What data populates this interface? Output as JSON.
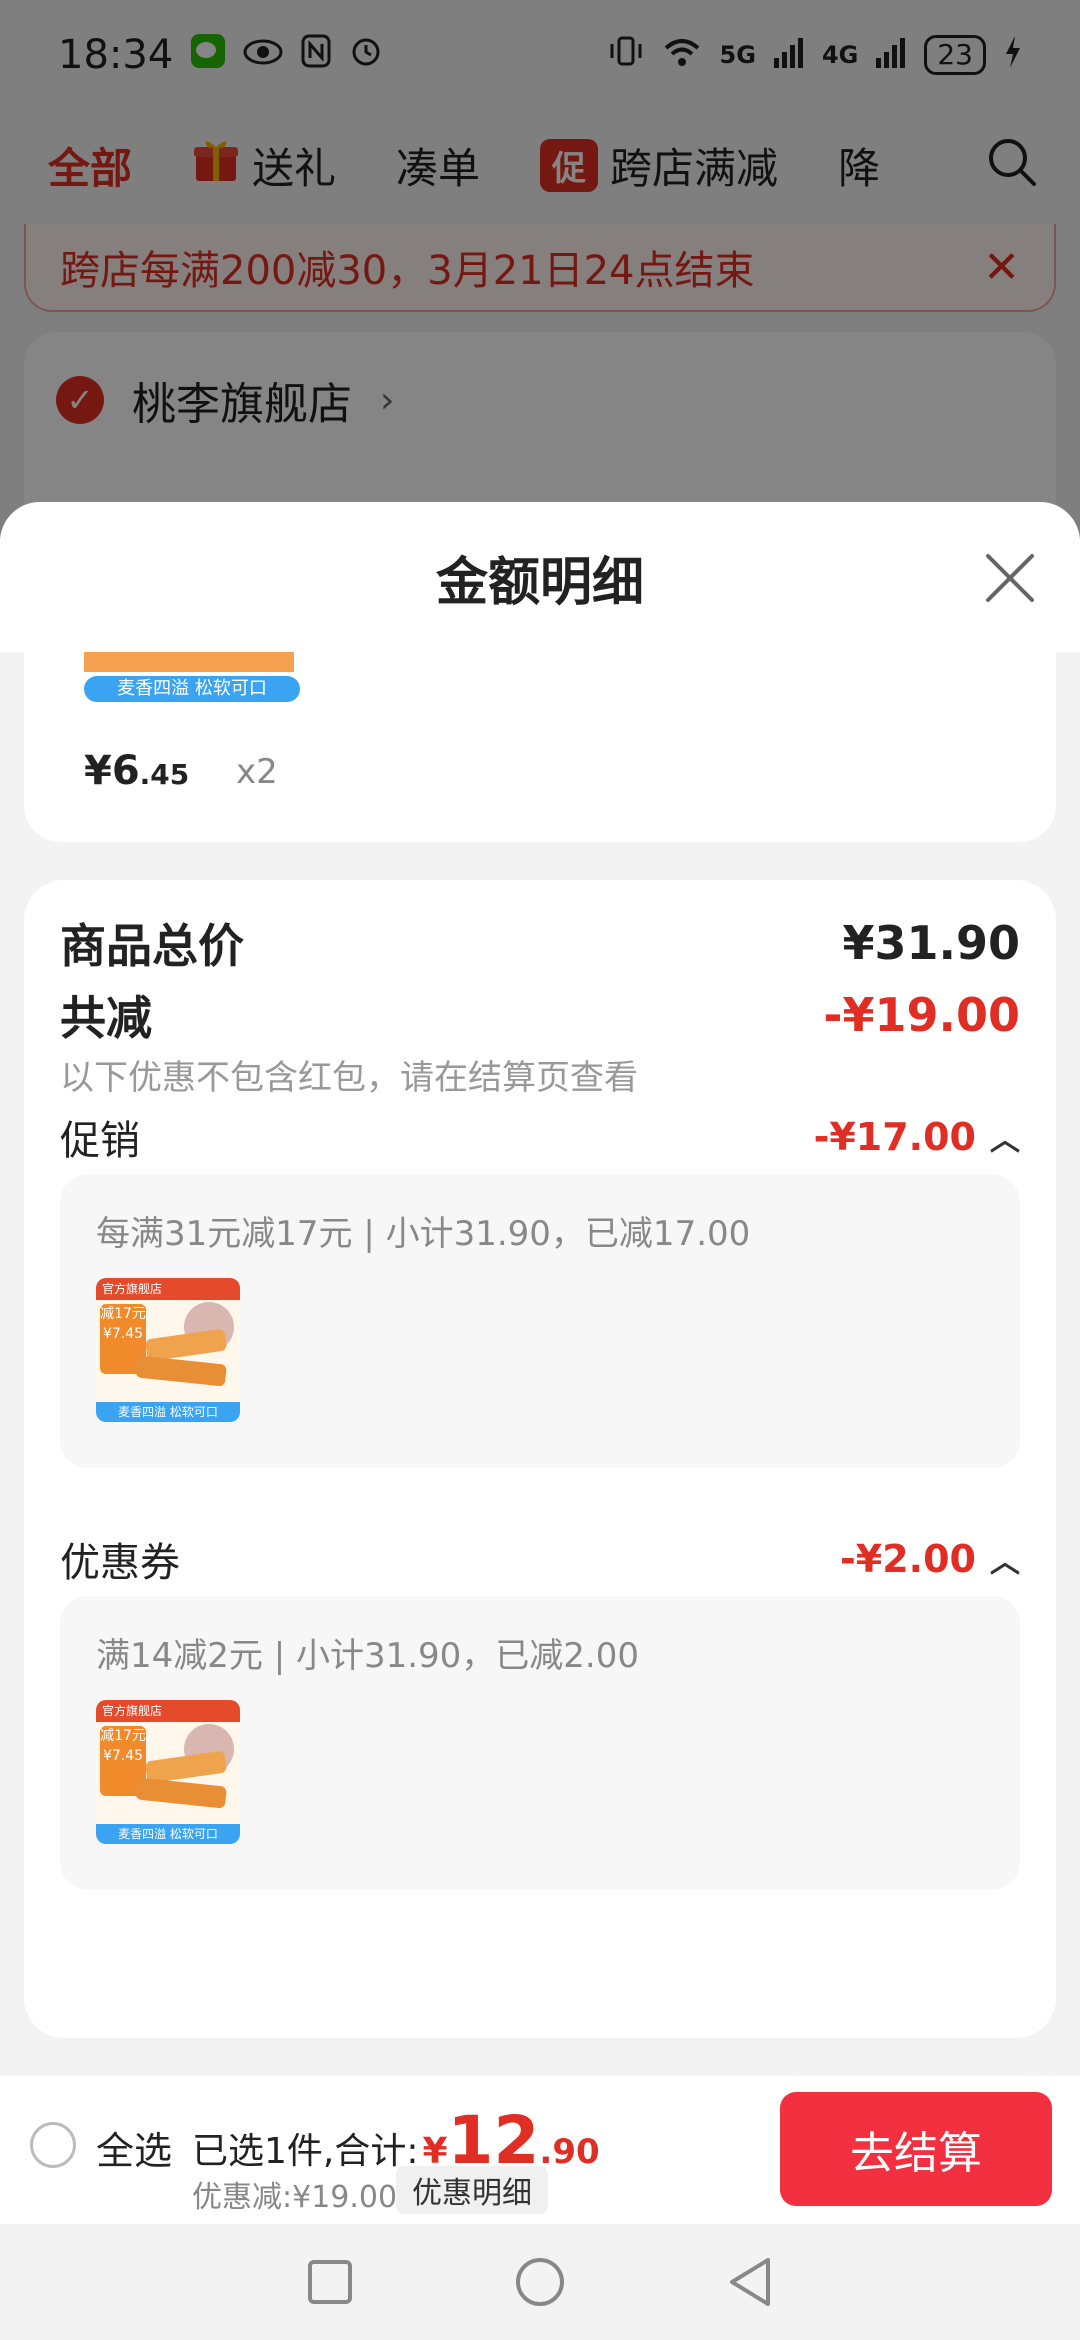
{
  "status_bar": {
    "time": "18:34",
    "signal_5g": "5G",
    "signal_4g": "4G",
    "battery": "23"
  },
  "top_nav": {
    "tabs": [
      "全部",
      "送礼",
      "凑单",
      "跨店满减",
      "降"
    ],
    "promo_badge": "促"
  },
  "promo_banner": {
    "text": "跨店每满200减30，3月21日24点结束"
  },
  "shop": {
    "name": "桃李旗舰店"
  },
  "sheet": {
    "title": "金额明细",
    "item": {
      "tag": "麦香四溢 松软可口",
      "price_int": "¥6",
      "price_dec": ".45",
      "qty": "x2"
    },
    "total_label": "商品总价",
    "total_value": "¥31.90",
    "reduce_label": "共减",
    "reduce_value": "-¥19.00",
    "reduce_note": "以下优惠不包含红包，请在结算页查看",
    "promotion": {
      "label": "促销",
      "value": "-¥17.00",
      "detail": "每满31元减17元 | 小计31.90，已减17.00"
    },
    "coupon": {
      "label": "优惠券",
      "value": "-¥2.00",
      "detail": "满14减2元 | 小计31.90，已减2.00"
    },
    "thumb": {
      "store_tag": "官方旗舰店",
      "badge": "减17元 ¥7.45",
      "bottom_tag": "麦香四溢 松软可口"
    }
  },
  "checkout": {
    "select_all": "全选",
    "selected_text": "已选1件,合计:",
    "currency": "¥",
    "total_int": "12",
    "total_dec": ".90",
    "discount_text": "优惠减:¥19.00",
    "detail_button": "优惠明细",
    "pay_button": "去结算"
  },
  "colors": {
    "accent_red": "#e02e24",
    "pay_button": "#f3303f"
  }
}
